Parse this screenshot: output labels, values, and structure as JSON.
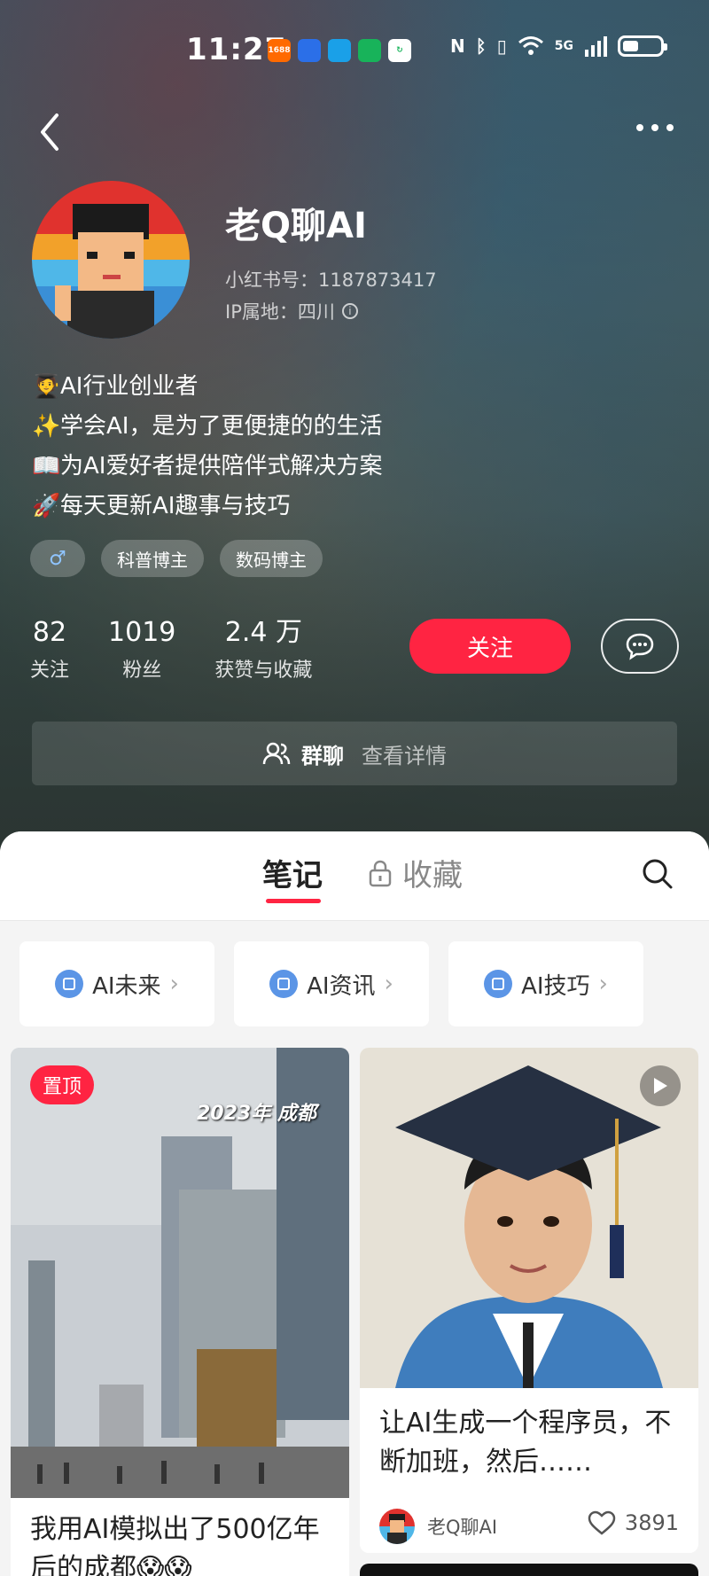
{
  "status": {
    "time": "11:27",
    "apps": [
      "1688",
      "dd",
      "ie",
      "wx",
      "c"
    ],
    "network": "5G"
  },
  "profile": {
    "nickname": "老Q聊AI",
    "red_id": "小红书号：1187873417",
    "ip": "IP属地：四川",
    "bio": [
      {
        "emoji": "🧑‍🎓",
        "text": "AI行业创业者"
      },
      {
        "emoji": "✨",
        "text": "学会AI，是为了更便捷的的生活"
      },
      {
        "emoji": "📖",
        "text": "为AI爱好者提供陪伴式解决方案"
      },
      {
        "emoji": "🚀",
        "text": "每天更新AI趣事与技巧"
      }
    ],
    "gender_symbol": "♂",
    "tags": [
      "科普博主",
      "数码博主"
    ],
    "stats": [
      {
        "num": "82",
        "label": "关注"
      },
      {
        "num": "1019",
        "label": "粉丝"
      },
      {
        "num": "2.4 万",
        "label": "获赞与收藏"
      }
    ],
    "follow_label": "关注"
  },
  "group": {
    "title": "群聊",
    "link": "查看详情"
  },
  "tabs": {
    "notes": "笔记",
    "favorites": "收藏"
  },
  "collections": [
    "AI未来",
    "AI资讯",
    "AI技巧"
  ],
  "cards": {
    "left": {
      "badge": "置顶",
      "overlay": "2023年 成都",
      "title": "我用AI模拟出了500亿年后的成都😱😱"
    },
    "right": {
      "title": "让AI生成一个程序员，不断加班，然后……",
      "author": "老Q聊AI",
      "likes": "3891"
    }
  },
  "colors": {
    "accent": "#ff2442",
    "collection_icon": "#5b95e6"
  }
}
